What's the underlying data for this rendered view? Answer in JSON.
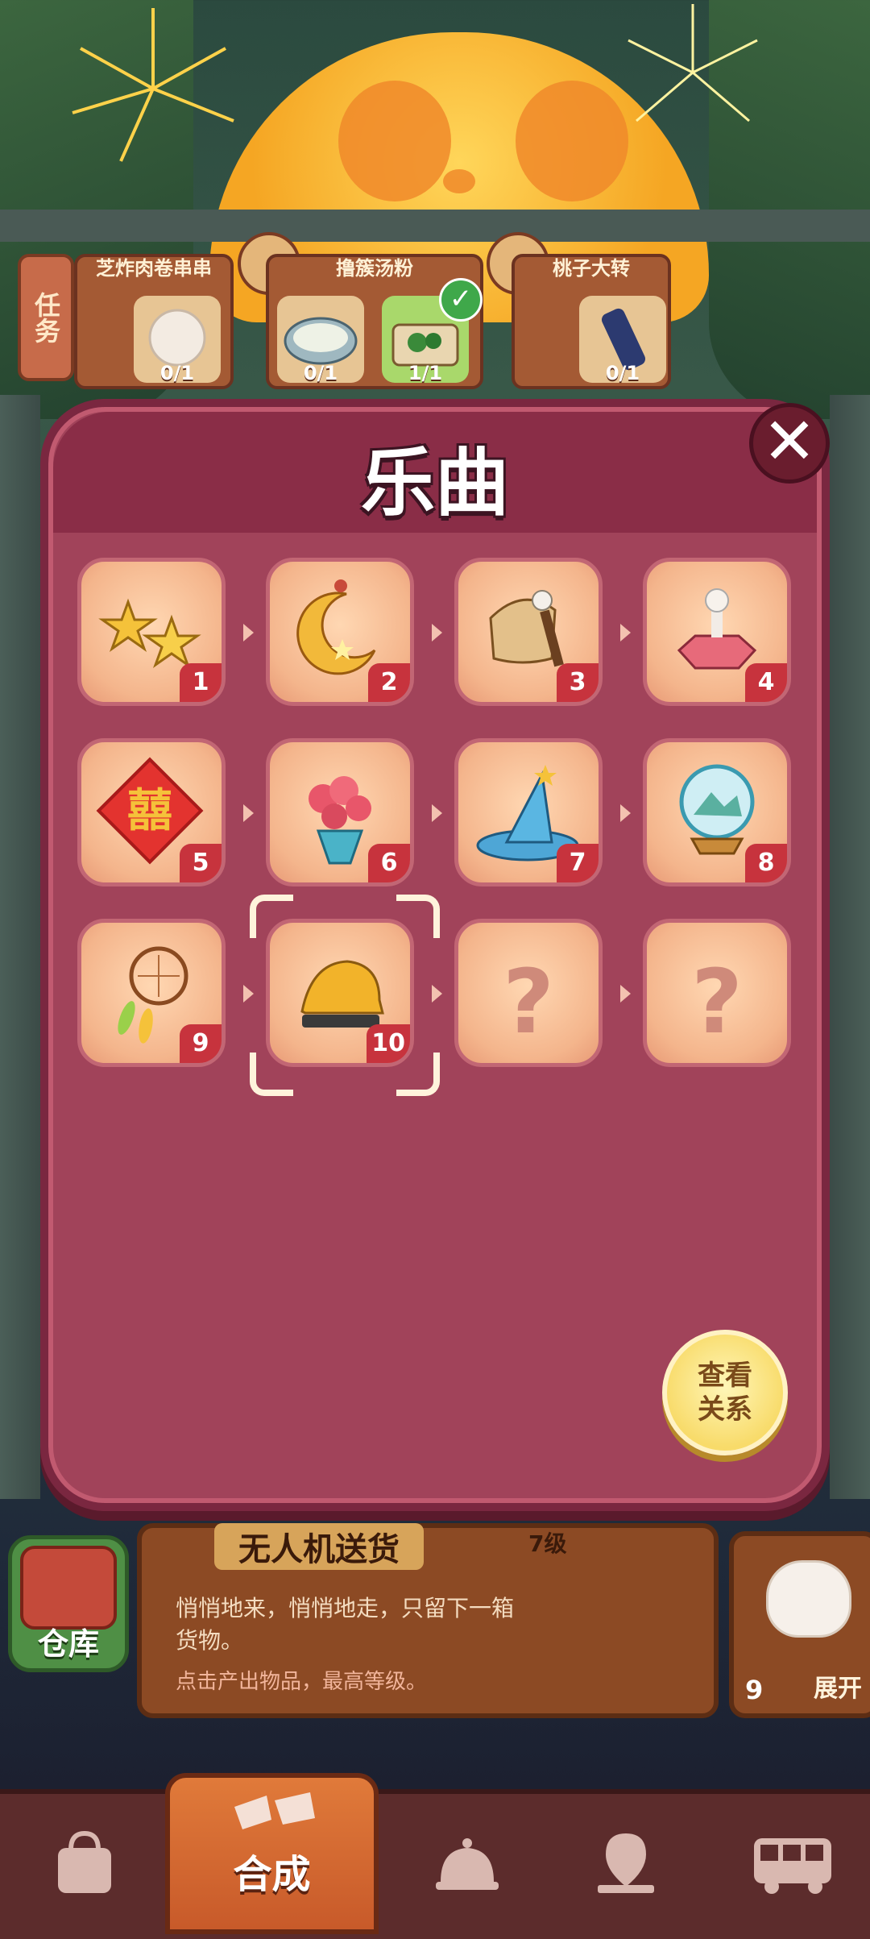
{
  "tasks": {
    "tab_label": "任务",
    "cards": [
      {
        "title": "芝炸肉卷串串",
        "count": "0/1"
      },
      {
        "title": "撸簇汤粉",
        "counts": [
          "0/1",
          "1/1"
        ]
      },
      {
        "title": "桃子大转",
        "count": "0/1"
      }
    ]
  },
  "modal": {
    "title": "乐曲",
    "close_symbol": "✕",
    "items": [
      {
        "num": "1",
        "icon": "star-earrings-icon",
        "known": true
      },
      {
        "num": "2",
        "icon": "crescent-moon-pendant-icon",
        "known": true
      },
      {
        "num": "3",
        "icon": "bell-hammer-icon",
        "known": true
      },
      {
        "num": "4",
        "icon": "music-box-icon",
        "known": true
      },
      {
        "num": "5",
        "icon": "double-happiness-icon",
        "known": true
      },
      {
        "num": "6",
        "icon": "rose-bouquet-icon",
        "known": true
      },
      {
        "num": "7",
        "icon": "wizard-hat-icon",
        "known": true
      },
      {
        "num": "8",
        "icon": "snow-globe-icon",
        "known": true
      },
      {
        "num": "9",
        "icon": "dreamcatcher-icon",
        "known": true
      },
      {
        "num": "10",
        "icon": "golden-bull-icon",
        "known": true
      },
      {
        "num": "",
        "icon": "unknown-icon",
        "known": false,
        "placeholder": "?"
      },
      {
        "num": "",
        "icon": "unknown-icon",
        "known": false,
        "placeholder": "?"
      }
    ],
    "selected_index": 9,
    "view_button": "查看关系"
  },
  "info": {
    "storage_label": "仓库",
    "title": "无人机送货",
    "level": "7级",
    "description": "悄悄地来，悄悄地走，只留下一箱货物。",
    "hint": "点击产出物品，最高等级。",
    "cat_count": "9",
    "cat_expand": "展开"
  },
  "nav": {
    "center_label": "合成",
    "items": [
      "bag-icon",
      "merge-icon",
      "bell-icon",
      "map-pin-icon",
      "bus-icon"
    ]
  },
  "colors": {
    "modal_bg": "#a1435a",
    "cell_bg": "#f4b58c",
    "badge": "#c7333d",
    "accent_button": "#f8db6a"
  }
}
